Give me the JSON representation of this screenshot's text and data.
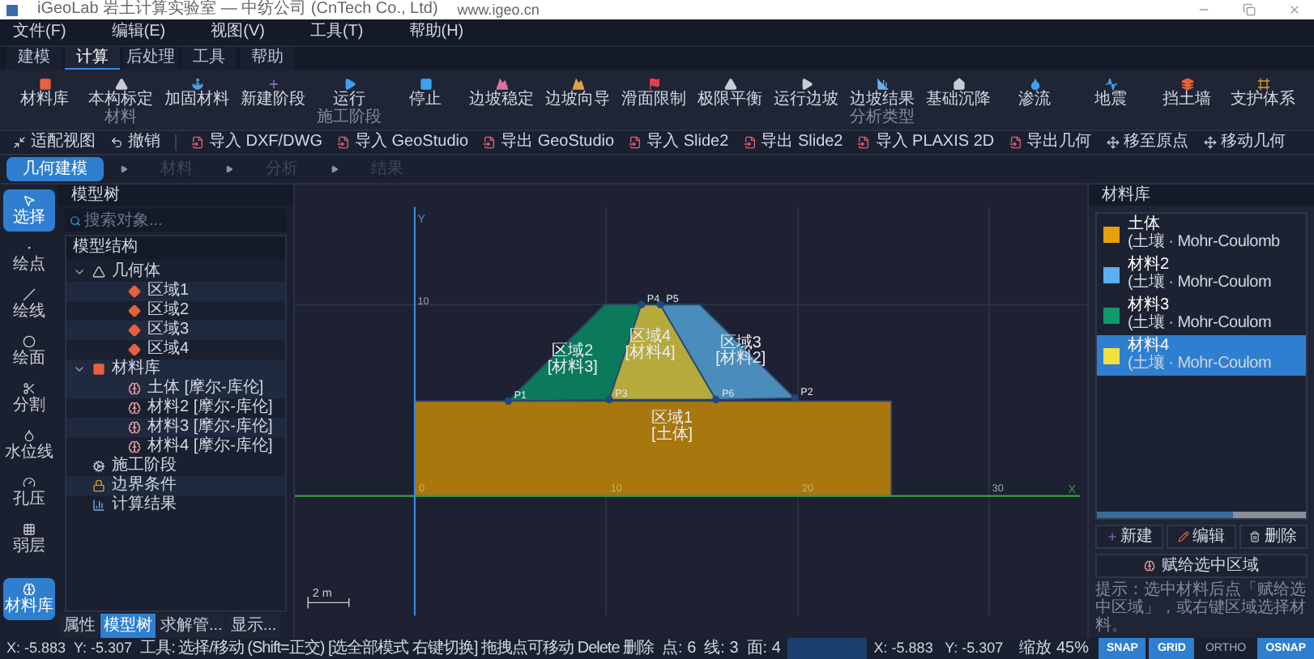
{
  "title_bar": {
    "title": "iGeoLab 岩土计算实验室 — 中纺公司 (CnTech Co., Ltd)",
    "url": "www.igeo.cn"
  },
  "menu": [
    "文件(F)",
    "编辑(E)",
    "视图(V)",
    "工具(T)",
    "帮助(H)"
  ],
  "tabs": [
    {
      "label": "建模",
      "selected": false
    },
    {
      "label": "计算",
      "selected": true
    },
    {
      "label": "后处理",
      "selected": false
    },
    {
      "label": "工具",
      "selected": false
    },
    {
      "label": "帮助",
      "selected": false
    }
  ],
  "ribbon": [
    {
      "label": "材料库"
    },
    {
      "label": "本构标定",
      "caption": "材料"
    },
    {
      "label": "加固材料"
    },
    {
      "label": "新建阶段"
    },
    {
      "label": "运行",
      "caption": "施工阶段"
    },
    {
      "label": "停止"
    },
    {
      "label": "边坡稳定"
    },
    {
      "label": "边坡向导"
    },
    {
      "label": "滑面限制"
    },
    {
      "label": "极限平衡"
    },
    {
      "label": "运行边坡"
    },
    {
      "label": "边坡结果",
      "caption": "分析类型"
    },
    {
      "label": "基础沉降"
    },
    {
      "label": "渗流"
    },
    {
      "label": "地震"
    },
    {
      "label": "挡土墙"
    },
    {
      "label": "支护体系"
    }
  ],
  "toolbar": [
    {
      "label": "适配视图",
      "kind": "fit"
    },
    {
      "label": "撤销",
      "kind": "undo"
    },
    {
      "label": "导入 DXF/DWG",
      "kind": "file"
    },
    {
      "label": "导入 GeoStudio",
      "kind": "file"
    },
    {
      "label": "导出 GeoStudio",
      "kind": "file"
    },
    {
      "label": "导入 Slide2",
      "kind": "file"
    },
    {
      "label": "导出 Slide2",
      "kind": "file"
    },
    {
      "label": "导入 PLAXIS 2D",
      "kind": "file"
    },
    {
      "label": "导出几何",
      "kind": "file"
    },
    {
      "label": "移至原点",
      "kind": "move"
    },
    {
      "label": "移动几何",
      "kind": "move"
    }
  ],
  "workflow": [
    {
      "label": "几何建模",
      "selected": true,
      "disabled": false
    },
    {
      "label": "材料",
      "selected": false,
      "disabled": true
    },
    {
      "label": "分析",
      "selected": false,
      "disabled": true
    },
    {
      "label": "结果",
      "selected": false,
      "disabled": true
    }
  ],
  "tools": [
    {
      "label": "选择",
      "selected": true
    },
    {
      "label": "绘点",
      "selected": false
    },
    {
      "label": "绘线",
      "selected": false
    },
    {
      "label": "绘面",
      "selected": false
    },
    {
      "label": "分割",
      "selected": false
    },
    {
      "label": "水位线",
      "selected": false
    },
    {
      "label": "孔压",
      "selected": false
    },
    {
      "label": "弱层",
      "selected": false
    },
    {
      "label": "材料库",
      "selected": true
    }
  ],
  "model_tree": {
    "title": "模型树",
    "search": {
      "placeholder": "搜索对象..."
    },
    "header": "模型结构",
    "items": [
      {
        "label": "几何体",
        "kind": "geometry",
        "expanded": true,
        "children": [
          {
            "label": "区域1",
            "kind": "region"
          },
          {
            "label": "区域2",
            "kind": "region"
          },
          {
            "label": "区域3",
            "kind": "region"
          },
          {
            "label": "区域4",
            "kind": "region"
          }
        ]
      },
      {
        "label": "材料库",
        "kind": "materials",
        "expanded": true,
        "children": [
          {
            "label": "土体 [摩尔-库伦]",
            "kind": "material"
          },
          {
            "label": "材料2 [摩尔-库伦]",
            "kind": "material"
          },
          {
            "label": "材料3 [摩尔-库伦]",
            "kind": "material"
          },
          {
            "label": "材料4 [摩尔-库伦]",
            "kind": "material"
          }
        ]
      },
      {
        "label": "施工阶段",
        "kind": "stage"
      },
      {
        "label": "边界条件",
        "kind": "boundary"
      },
      {
        "label": "计算结果",
        "kind": "results"
      }
    ]
  },
  "panel_tabs": [
    {
      "label": "属性",
      "selected": false
    },
    {
      "label": "模型树",
      "selected": true
    },
    {
      "label": "求解管...",
      "selected": false
    },
    {
      "label": "显示...",
      "selected": false
    }
  ],
  "canvas": {
    "x_axis": "X",
    "y_axis": "Y",
    "x_ticks": [
      "0",
      "10",
      "20",
      "30"
    ],
    "y_ticks": [
      "10"
    ],
    "scale": "2 m",
    "regions": [
      {
        "label": "区域2",
        "material": "[材料3]",
        "color": "#0b7a5a"
      },
      {
        "label": "区域4",
        "material": "[材料4]",
        "color": "#b6aa3c"
      },
      {
        "label": "区域3",
        "material": "[材料2]",
        "color": "#4a8cbc"
      },
      {
        "label": "区域1",
        "material": "[土体]",
        "color": "#a8780e"
      }
    ],
    "points": [
      "P1",
      "P3",
      "P4",
      "P5",
      "P6",
      "P2"
    ]
  },
  "materials_panel": {
    "title": "材料库",
    "materials": [
      {
        "name": "土体",
        "type": "(土壤 · Mohr-Coulomb",
        "color": "#e6a00c",
        "selected": false
      },
      {
        "name": "材料2",
        "type": "(土壤 · Mohr-Coulom",
        "color": "#5ab0f0",
        "selected": false
      },
      {
        "name": "材料3",
        "type": "(土壤 · Mohr-Coulom",
        "color": "#0f9a6e",
        "selected": false
      },
      {
        "name": "材料4",
        "type": "(土壤 · Mohr-Coulom",
        "color": "#f0e040",
        "selected": true
      }
    ],
    "buttons": [
      {
        "label": "新建",
        "kind": "new"
      },
      {
        "label": "编辑",
        "kind": "edit"
      },
      {
        "label": "删除",
        "kind": "delete"
      }
    ],
    "assign_button": "赋给选中区域",
    "hint": "提示：选中材料后点「赋给选中区域」，或右键区域选择材料。"
  },
  "status_bar": {
    "x": "X: -5.883",
    "y": "Y: -5.307",
    "tool": "工具: 选择/移动 (Shift=正交) [选全部模式 右键切换] 拖拽点可移动 Delete 删除",
    "counts": [
      "点: 6",
      "线: 3",
      "面: 4"
    ],
    "coords": "X: -5.883   Y: -5.307",
    "zoom": "缩放 45%",
    "toggles": [
      {
        "label": "SNAP",
        "on": true
      },
      {
        "label": "GRID",
        "on": true
      },
      {
        "label": "ORTHO",
        "on": false
      },
      {
        "label": "OSNAP",
        "on": true
      }
    ]
  }
}
